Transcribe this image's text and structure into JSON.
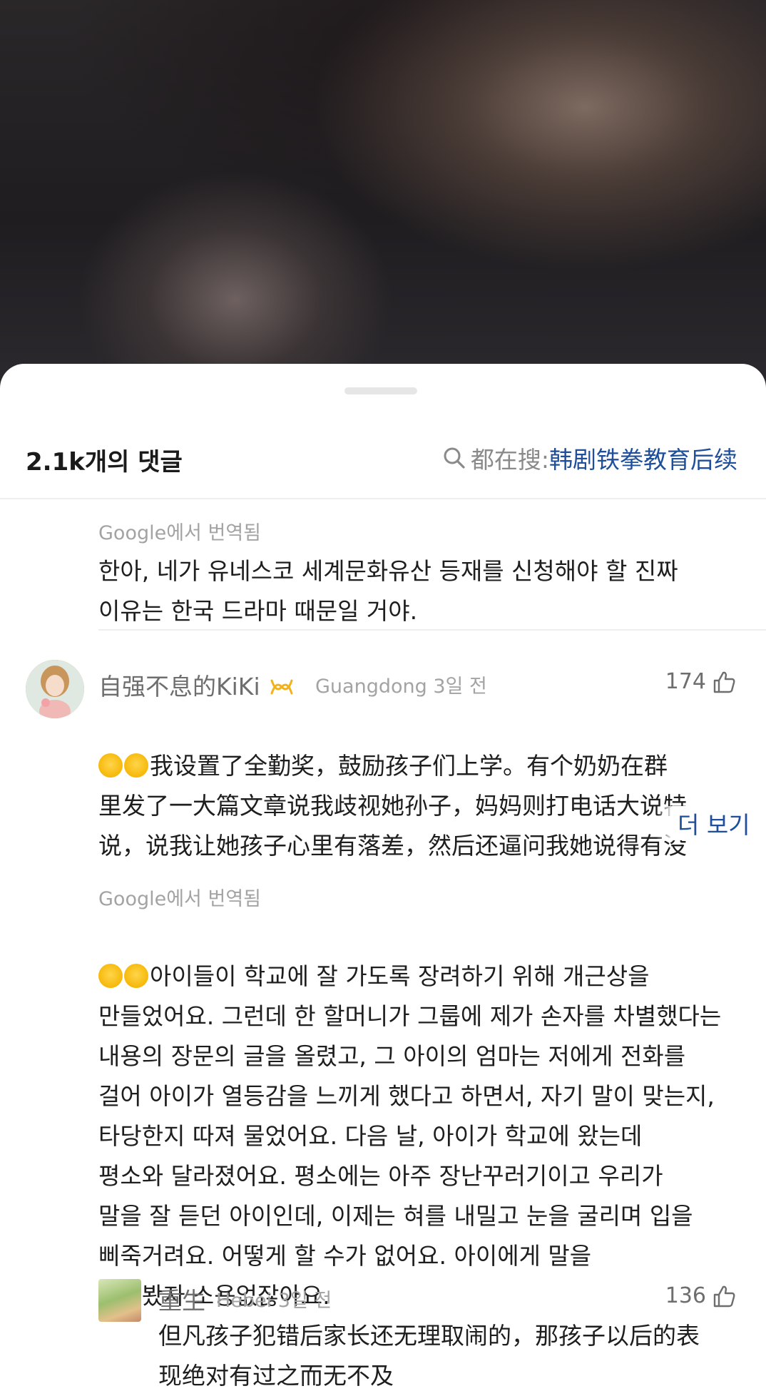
{
  "header": {
    "comment_count": "2.1k개의 댓글",
    "search_prefix": "都在搜:",
    "search_term": "韩剧铁拳教育后续"
  },
  "translation_1": {
    "label": "Google에서 번역됨",
    "text": "한아, 네가 유네스코 세계문화유산 등재를 신청해야 할 진짜\n이유는 한국 드라마 때문일 거야."
  },
  "comment_1": {
    "username": "自强不息的KiKi",
    "location": "Guangdong",
    "time": "3일 전",
    "likes": "174",
    "text": "我设置了全勤奖，鼓励孩子们上学。有个奶奶在群\n里发了一大篇文章说我歧视她孙子，妈妈则打电话大说特\n说，说我让她孩子心里有落差，然后还逼问我她说得有没\n有道理、对不对第二天那孩子回来上学不一样了",
    "more_label": "더 보기"
  },
  "translation_2": {
    "label": "Google에서 번역됨",
    "text": "아이들이 학교에 잘 가도록 장려하기 위해 개근상을\n만들었어요. 그런데 한 할머니가 그룹에 제가 손자를 차별했다는\n내용의 장문의 글을 올렸고, 그 아이의 엄마는 저에게 전화를\n걸어 아이가 열등감을 느끼게 했다고 하면서, 자기 말이 맞는지,\n타당한지 따져 물었어요. 다음 날, 아이가 학교에 왔는데\n평소와 달라졌어요. 평소에는 아주 장난꾸러기이고 우리가\n말을 잘 듣던 아이인데, 이제는 혀를 내밀고 눈을 굴리며 입을\n삐죽거려요. 어떻게 할 수가 없어요. 아이에게 말을\n걸어봤자 소용없잖아요."
  },
  "reply_1": {
    "username": "重生",
    "location": "Hebei",
    "time": "3일 전",
    "likes": "136",
    "text": "但凡孩子犯错后家长还无理取闹的，那孩子以后的表\n现绝对有过之而无不及"
  },
  "icons": {
    "search": "search-icon",
    "like": "thumbs-up-icon",
    "badge": "infinity-badge-icon",
    "emoji": "crying-face-emoji"
  }
}
